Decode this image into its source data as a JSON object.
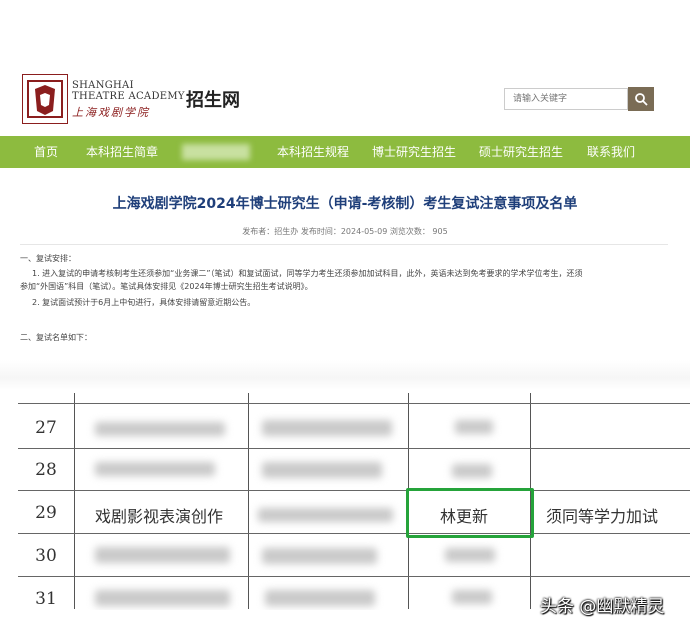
{
  "header": {
    "logo_en_line1": "SHANGHAI",
    "logo_en_line2": "THEATRE ACADEMY",
    "logo_cn": "上海戏剧学院",
    "site_name": "招生网",
    "search_placeholder": "请输入关键字",
    "search_icon": "magnifier-icon"
  },
  "nav": {
    "items": [
      "首页",
      "本科招生简章",
      "本科招生规程",
      "博士研究生招生",
      "硕士研究生招生",
      "联系我们"
    ]
  },
  "article": {
    "title": "上海戏剧学院2024年博士研究生（申请-考核制）考生复试注意事项及名单",
    "meta": "发布者：招生办  发布时间：2024-05-09  浏览次数：  905",
    "p1": "一、复试安排：",
    "p2a": "1. 进入复试的申请考核制考生还须参加“业务课二”（笔试）和复试面试，同等学力考生还须参加加试科目，此外，英语未达到免考要求的学术学位考生，还须",
    "p2b": "参加“外国语”科目（笔试）。笔试具体安排见《2024年博士研究生招生考试说明》。",
    "p3": "2. 复试面试预计于6月上中旬进行，具体安排请留意近期公告。",
    "p4": "二、复试名单如下："
  },
  "table": {
    "rows": [
      {
        "no": "27",
        "major": "",
        "name": "",
        "note": ""
      },
      {
        "no": "28",
        "major": "",
        "name": "",
        "note": ""
      },
      {
        "no": "29",
        "major": "戏剧影视表演创作",
        "name": "林更新",
        "note": "须同等学力加试"
      },
      {
        "no": "30",
        "major": "",
        "name": "",
        "note": ""
      },
      {
        "no": "31",
        "major": "",
        "name": "",
        "note": ""
      }
    ]
  },
  "watermark": "头条 @幽默精灵",
  "colors": {
    "nav_green": "#8dbb3f",
    "title_blue": "#1f3f7a",
    "logo_red": "#8b1e1e",
    "highlight_green": "#25a33a"
  }
}
